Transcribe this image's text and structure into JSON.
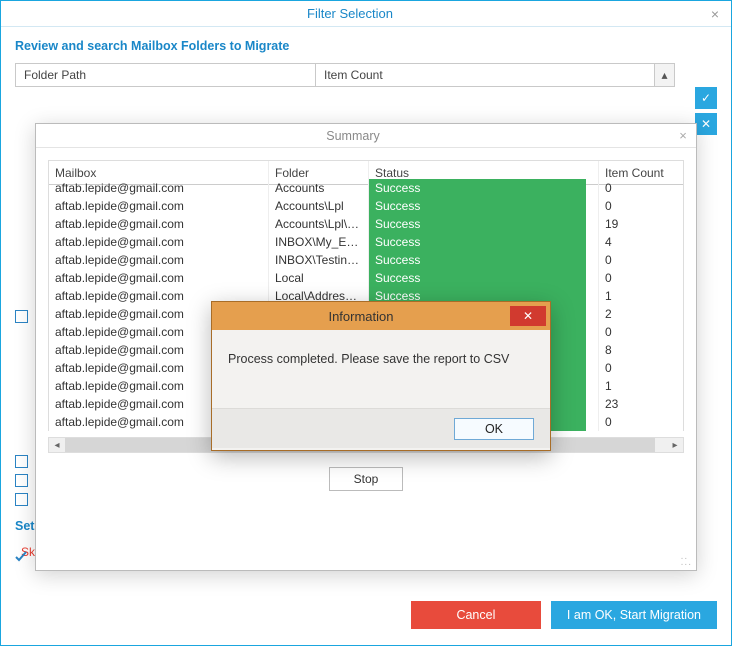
{
  "window": {
    "title": "Filter Selection",
    "close_glyph": "×"
  },
  "section_label": "Review and search Mailbox Folders to Migrate",
  "grid_headers": {
    "folder_path": "Folder Path",
    "item_count": "Item Count",
    "scroll_up_glyph": "▴"
  },
  "side_icons": {
    "check_all_glyph": "✓",
    "clear_all_glyph": "✕"
  },
  "bottom": {
    "set_label": "Set",
    "skip_label": "Skip Previously Migrated Items ( Incremental )",
    "cancel": "Cancel",
    "start": "I am OK, Start Migration"
  },
  "summary": {
    "title": "Summary",
    "close_glyph": "×",
    "headers": {
      "mailbox": "Mailbox",
      "folder": "Folder",
      "status": "Status",
      "item_count": "Item Count"
    },
    "rows": [
      {
        "mailbox": "aftab.lepide@gmail.com",
        "folder": "Accounts",
        "status": "Success",
        "count": "0"
      },
      {
        "mailbox": "aftab.lepide@gmail.com",
        "folder": "Accounts\\Lpl",
        "status": "Success",
        "count": "0"
      },
      {
        "mailbox": "aftab.lepide@gmail.com",
        "folder": "Accounts\\Lpl\\N...",
        "status": "Success",
        "count": "19"
      },
      {
        "mailbox": "aftab.lepide@gmail.com",
        "folder": "INBOX\\My_Emails",
        "status": "Success",
        "count": "4"
      },
      {
        "mailbox": "aftab.lepide@gmail.com",
        "folder": "INBOX\\Testing M",
        "status": "Success",
        "count": "0"
      },
      {
        "mailbox": "aftab.lepide@gmail.com",
        "folder": "Local",
        "status": "Success",
        "count": "0"
      },
      {
        "mailbox": "aftab.lepide@gmail.com",
        "folder": "Local\\Address B...",
        "status": "Success",
        "count": "1"
      },
      {
        "mailbox": "aftab.lepide@gmail.com",
        "folder": "",
        "status": "",
        "count": "2"
      },
      {
        "mailbox": "aftab.lepide@gmail.com",
        "folder": "",
        "status": "",
        "count": "0"
      },
      {
        "mailbox": "aftab.lepide@gmail.com",
        "folder": "",
        "status": "",
        "count": "8"
      },
      {
        "mailbox": "aftab.lepide@gmail.com",
        "folder": "",
        "status": "",
        "count": "0"
      },
      {
        "mailbox": "aftab.lepide@gmail.com",
        "folder": "",
        "status": "",
        "count": "1"
      },
      {
        "mailbox": "aftab.lepide@gmail.com",
        "folder": "",
        "status": "",
        "count": "23"
      },
      {
        "mailbox": "aftab.lepide@gmail.com",
        "folder": "",
        "status": "",
        "count": "0"
      }
    ],
    "stop": "Stop",
    "harrow_left": "◂",
    "harrow_right": "▸"
  },
  "info": {
    "title": "Information",
    "close_glyph": "✕",
    "message": "Process completed. Please save the report to CSV",
    "ok": "OK"
  }
}
